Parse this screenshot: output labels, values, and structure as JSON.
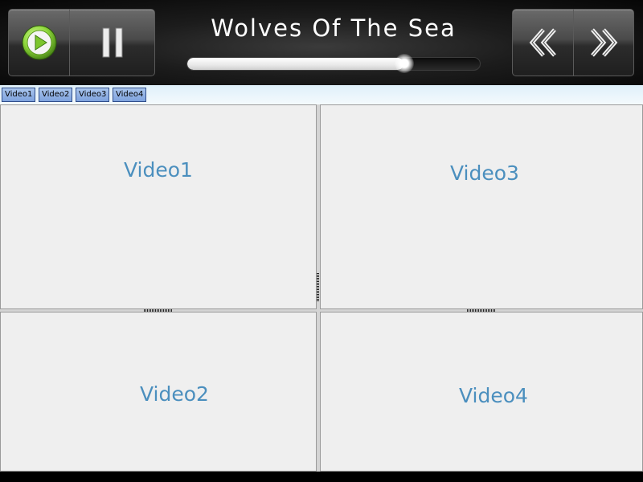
{
  "player": {
    "title": "Wolves Of The Sea",
    "progress_percent": 74,
    "controls": {
      "play_icon": "play-icon",
      "pause_icon": "pause-icon",
      "prev_icon": "skip-back-icon",
      "next_icon": "skip-forward-icon"
    },
    "colors": {
      "play_accent": "#8dd63a",
      "progress_fill": "#ffffff"
    }
  },
  "tabs": [
    {
      "label": "Video1"
    },
    {
      "label": "Video2"
    },
    {
      "label": "Video3"
    },
    {
      "label": "Video4"
    }
  ],
  "videos": {
    "top_left": {
      "label": "Video1"
    },
    "bottom_left": {
      "label": "Video2"
    },
    "top_right": {
      "label": "Video3"
    },
    "bottom_right": {
      "label": "Video4"
    },
    "label_color": "#4b8fbe"
  }
}
